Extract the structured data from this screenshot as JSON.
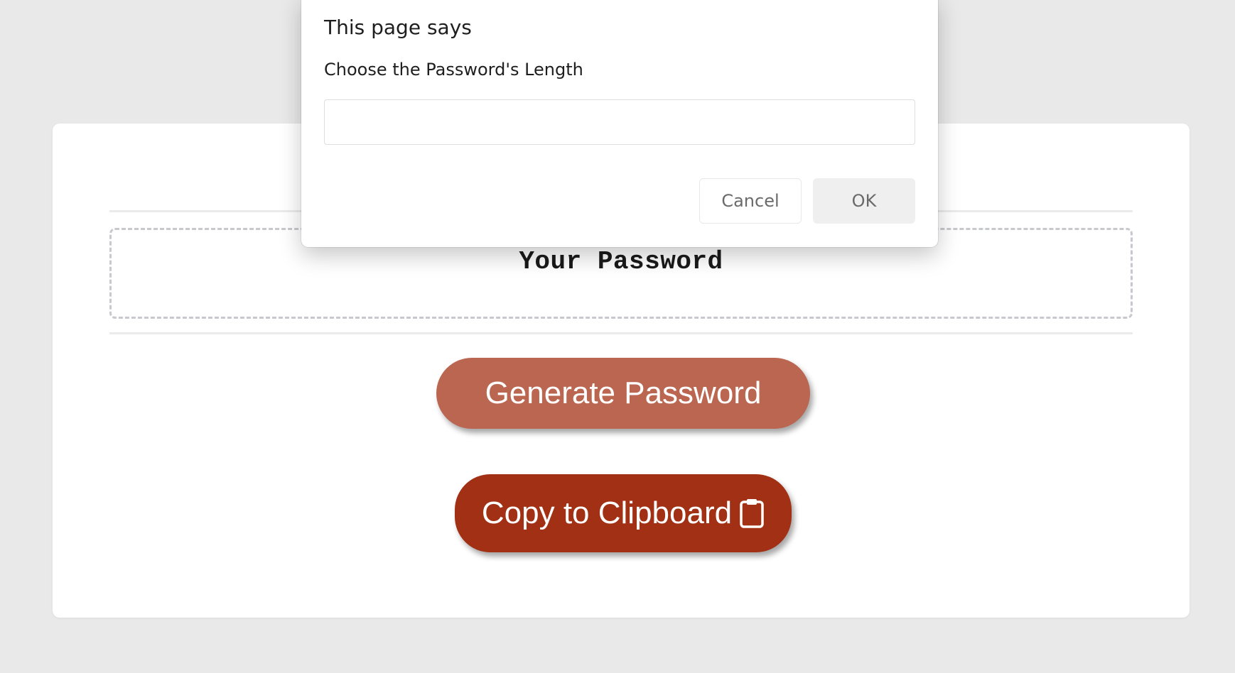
{
  "page": {
    "background_color": "#e9e9e9"
  },
  "card": {
    "password_placeholder": "Your Password",
    "generate_label": "Generate Password",
    "copy_label": "Copy to Clipboard",
    "copy_icon": "clipboard-icon",
    "generate_color": "#bb6650",
    "copy_color": "#a23014"
  },
  "dialog": {
    "title": "This page says",
    "message": "Choose the Password's Length",
    "input_value": "",
    "cancel_label": "Cancel",
    "ok_label": "OK"
  }
}
